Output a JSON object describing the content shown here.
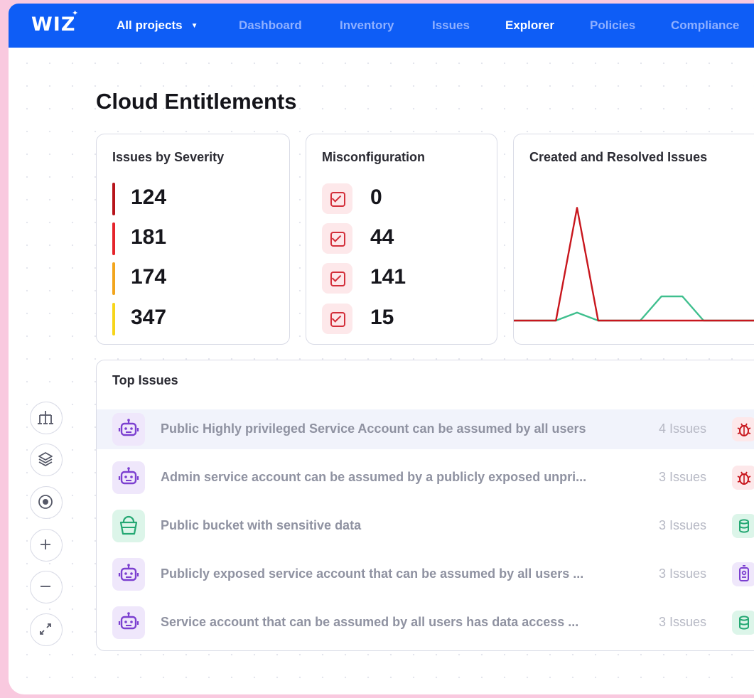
{
  "app": {
    "logo": "WIZ"
  },
  "nav": {
    "project_selector": "All projects",
    "items": [
      {
        "label": "Dashboard",
        "active": false
      },
      {
        "label": "Inventory",
        "active": false
      },
      {
        "label": "Issues",
        "active": false
      },
      {
        "label": "Explorer",
        "active": true
      },
      {
        "label": "Policies",
        "active": false
      },
      {
        "label": "Compliance",
        "active": false
      }
    ]
  },
  "page": {
    "title": "Cloud Entitlements"
  },
  "severity_card": {
    "title": "Issues by Severity",
    "rows": [
      {
        "value": "124",
        "color": "#b7141b"
      },
      {
        "value": "181",
        "color": "#e5242b"
      },
      {
        "value": "174",
        "color": "#f2a51c"
      },
      {
        "value": "347",
        "color": "#f7d51a"
      }
    ]
  },
  "misconfig_card": {
    "title": "Misconfiguration",
    "rows": [
      {
        "value": "0"
      },
      {
        "value": "44"
      },
      {
        "value": "141"
      },
      {
        "value": "15"
      }
    ]
  },
  "trend_card": {
    "title": "Created and Resolved Issues"
  },
  "chart_data": {
    "type": "line",
    "title": "Created and Resolved Issues",
    "x": [
      0,
      1,
      2,
      3,
      4,
      5,
      6,
      7,
      8,
      9,
      10,
      11,
      12
    ],
    "series": [
      {
        "color": "#c8161d",
        "values": [
          0,
          0,
          0,
          14,
          0,
          0,
          0,
          0,
          0,
          0,
          0,
          0,
          0
        ]
      },
      {
        "color": "#3fbf8e",
        "values": [
          0,
          0,
          0,
          1,
          0,
          0,
          0,
          3,
          3,
          0,
          0,
          0,
          0
        ]
      }
    ],
    "ylim": [
      0,
      15
    ]
  },
  "top_issues": {
    "title": "Top Issues",
    "rows": [
      {
        "icon": "robot-icon",
        "text": "Public Highly privileged Service Account can be assumed by all users",
        "count": "4 Issues",
        "tag": "bug-icon",
        "highlight": true
      },
      {
        "icon": "robot-icon",
        "text": "Admin service account can be assumed by a publicly exposed unpri...",
        "count": "3 Issues",
        "tag": "bug-icon",
        "highlight": false
      },
      {
        "icon": "bucket-icon",
        "text": "Public bucket with sensitive data",
        "count": "3 Issues",
        "tag": "database-icon",
        "highlight": false
      },
      {
        "icon": "robot-icon",
        "text": "Publicly exposed service account that can be assumed by all users ...",
        "count": "3 Issues",
        "tag": "id-badge-icon",
        "highlight": false
      },
      {
        "icon": "robot-icon",
        "text": "Service account that can be assumed by all users has data access ...",
        "count": "3 Issues",
        "tag": "database-icon",
        "highlight": false
      }
    ]
  },
  "toolbar": {
    "tools": [
      "hierarchy-icon",
      "layers-icon",
      "target-icon",
      "zoom-in-icon",
      "zoom-out-icon",
      "expand-icon"
    ]
  }
}
